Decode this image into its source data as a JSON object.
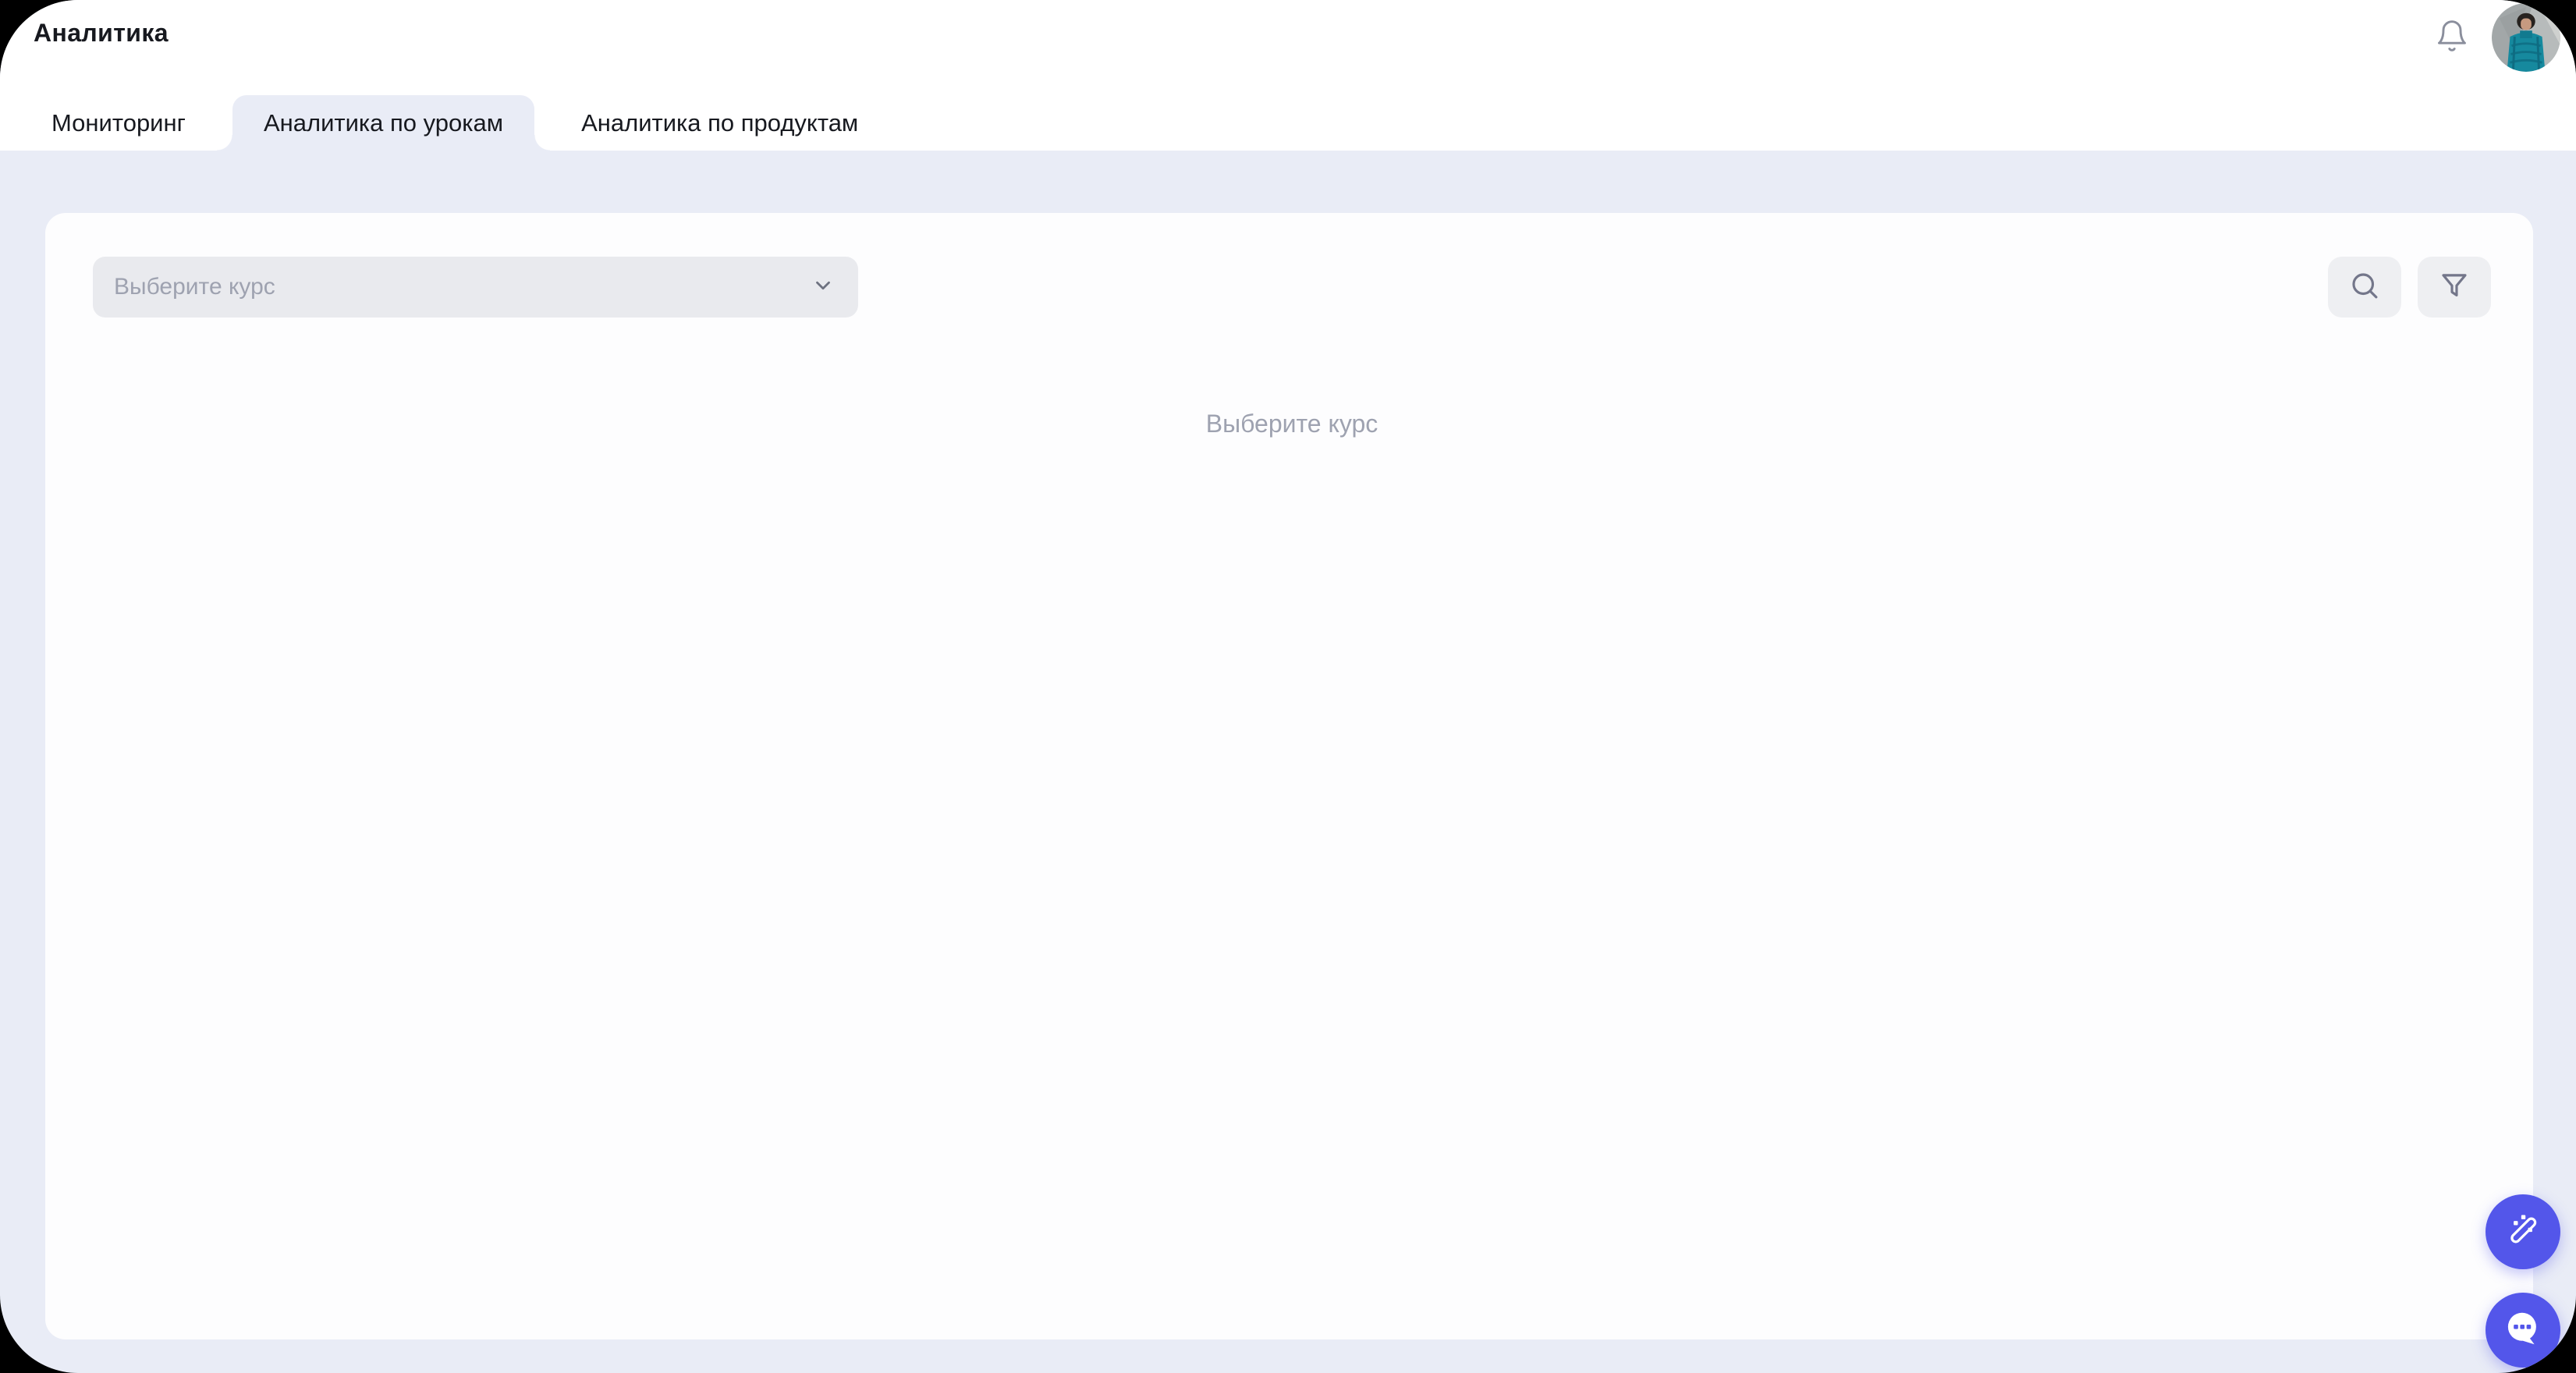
{
  "header": {
    "title": "Аналитика",
    "bell_icon": "bell-icon",
    "avatar": "user-avatar-photo"
  },
  "tabs": {
    "items": [
      {
        "label": "Мониторинг",
        "active": false
      },
      {
        "label": "Аналитика по урокам",
        "active": true
      },
      {
        "label": "Аналитика по продуктам",
        "active": false
      }
    ]
  },
  "card": {
    "course_select": {
      "placeholder": "Выберите курс",
      "icon": "chevron-down-icon"
    },
    "actions": [
      {
        "icon": "search-icon"
      },
      {
        "icon": "filter-icon"
      }
    ],
    "empty_state": {
      "message": "Выберите курс"
    }
  },
  "fabs": [
    {
      "icon": "magic-wand-icon"
    },
    {
      "icon": "chat-icon"
    }
  ],
  "colors": {
    "accent": "#5356EA",
    "page-bg": "#E9ECF6",
    "card-bg": "#FDFDFE",
    "header-bg": "#FFFFFF",
    "control-bg": "#E9EAEE",
    "icon-button-bg": "#EEEFF2",
    "text-dark": "#17191F",
    "text-muted": "#9EA2B0",
    "icon-gray": "#787C8B"
  }
}
